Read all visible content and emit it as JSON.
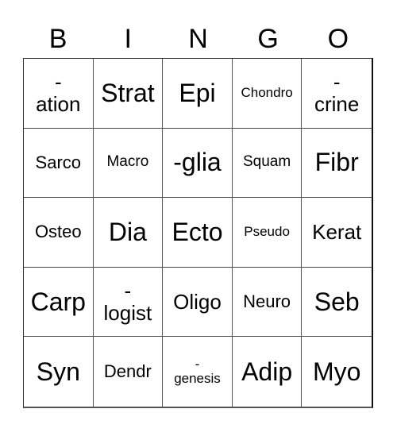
{
  "header": {
    "letters": [
      "B",
      "I",
      "N",
      "G",
      "O"
    ]
  },
  "card": {
    "rows": [
      [
        "-\nation",
        "Strat",
        "Epi",
        "Chondro",
        "-\ncrine"
      ],
      [
        "Sarco",
        "Macro",
        "-glia",
        "Squam",
        "Fibr"
      ],
      [
        "Osteo",
        "Dia",
        "Ecto",
        "Pseudo",
        "Kerat"
      ],
      [
        "Carp",
        "-\nlogist",
        "Oligo",
        "Neuro",
        "Seb"
      ],
      [
        "Syn",
        "Dendr",
        "-\ngenesis",
        "Adip",
        "Myo"
      ]
    ]
  }
}
